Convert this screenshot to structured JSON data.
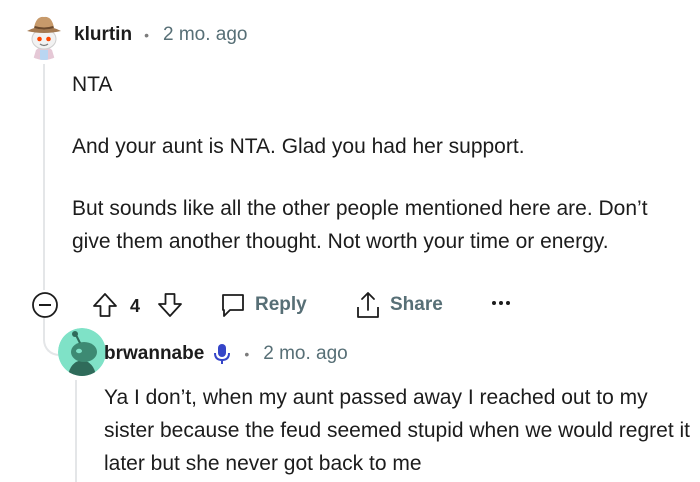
{
  "comment": {
    "username": "klurtin",
    "time": "2 mo. ago",
    "paragraphs": [
      "NTA",
      "And your aunt is NTA. Glad you had her support.",
      "But sounds like all the other people mentioned here are. Don’t give them another thought. Not worth your time or energy."
    ],
    "actions": {
      "vote_count": "4",
      "reply_label": "Reply",
      "share_label": "Share"
    }
  },
  "reply": {
    "username": "brwannabe",
    "time": "2 mo. ago",
    "body": "Ya I don’t, when my aunt passed away I reached out to my sister because the feud seemed stupid when we would regret it later but she never got back to me"
  },
  "colors": {
    "meta_text": "#576f76",
    "reply_avatar_bg": "#7fe2c7",
    "thread_line": "#e4e6e8"
  }
}
